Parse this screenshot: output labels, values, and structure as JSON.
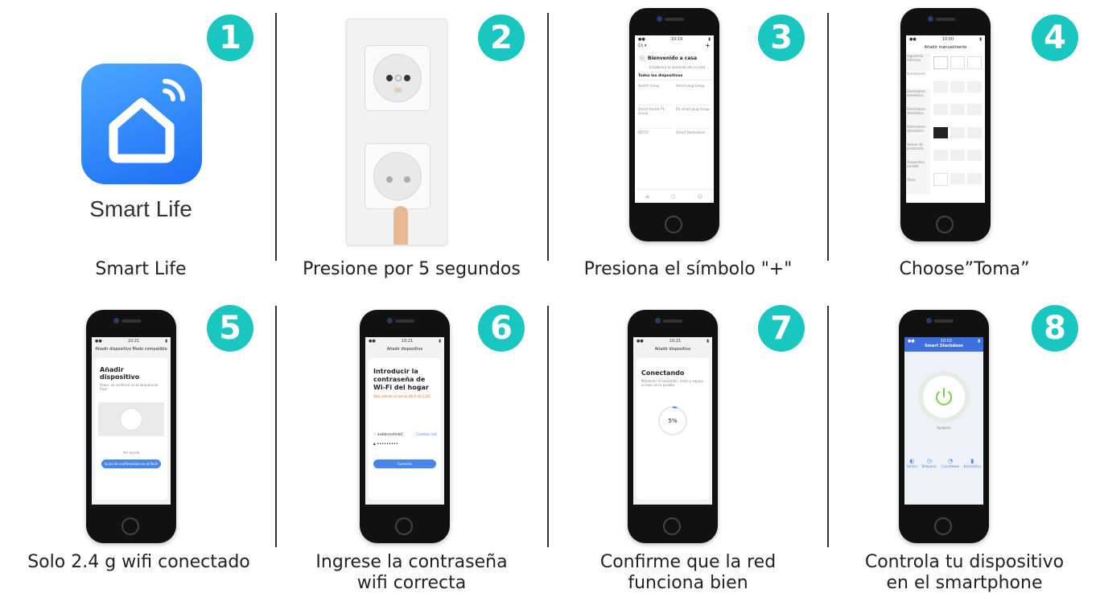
{
  "steps": [
    {
      "num": "1",
      "caption": "Smart Life"
    },
    {
      "num": "2",
      "caption": "Presione por 5 segundos"
    },
    {
      "num": "3",
      "caption": "Presiona el símbolo \"+\""
    },
    {
      "num": "4",
      "caption": "Choose”Toma”"
    },
    {
      "num": "5",
      "caption": "Solo 2.4 g wifi conectado"
    },
    {
      "num": "6",
      "caption": "Ingrese la contraseña\nwifi correcta"
    },
    {
      "num": "7",
      "caption": "Confirme que la red\nfunciona bien"
    },
    {
      "num": "8",
      "caption": "Controla tu dispositivo\nen el smartphone"
    }
  ],
  "app": {
    "name": "Smart Life"
  },
  "screen3": {
    "welcome": "Bienvenido a casa",
    "section": "Todos los dispositivos",
    "devices": [
      "Switch Group",
      "Smart plug Group",
      "Smart Socket P1 Group",
      "EU smart plug Group",
      "DSTST",
      "Smart Stecksdose"
    ]
  },
  "screen4": {
    "title": "Añadir manualmente",
    "categories": [
      "Ingeniería eléctrica",
      "Iluminación",
      "Electrodom. doméstico",
      "Electrodom. doméstico",
      "Electrodom. doméstico",
      "Sensor de protección",
      "Dispositivo portátil",
      "Otros"
    ]
  },
  "screen5": {
    "nav": "Añadir dispositivo Modo compatible",
    "title": "Añadir dispositivo",
    "desc": "Poder, se confirmó en la lámpara de flash",
    "link": "Ver ayuda",
    "button": "la luz de confirmación en el flash"
  },
  "screen6": {
    "nav": "Añadir dispositivo",
    "title": "Introducir la contraseña de Wi-Fi del hogar",
    "warning": "Sólo admite la red de Wi-Fi de 2,4G",
    "wifi": "avatarcontrolo1",
    "change": "Cambiar red",
    "password": "•••••••••",
    "button": "Correcto"
  },
  "screen7": {
    "nav": "Añadir dispositivo",
    "title": "Conectando",
    "desc": "Mantener el enrutador, móvil y equipo lo más cerca posible",
    "percent": "5%",
    "progress": 0.05
  },
  "screen8": {
    "nav": "Smart Steckdose",
    "status": "Apagado",
    "tabs": [
      "Switch",
      "Temporiz.",
      "Countdown",
      "Estadística"
    ]
  }
}
